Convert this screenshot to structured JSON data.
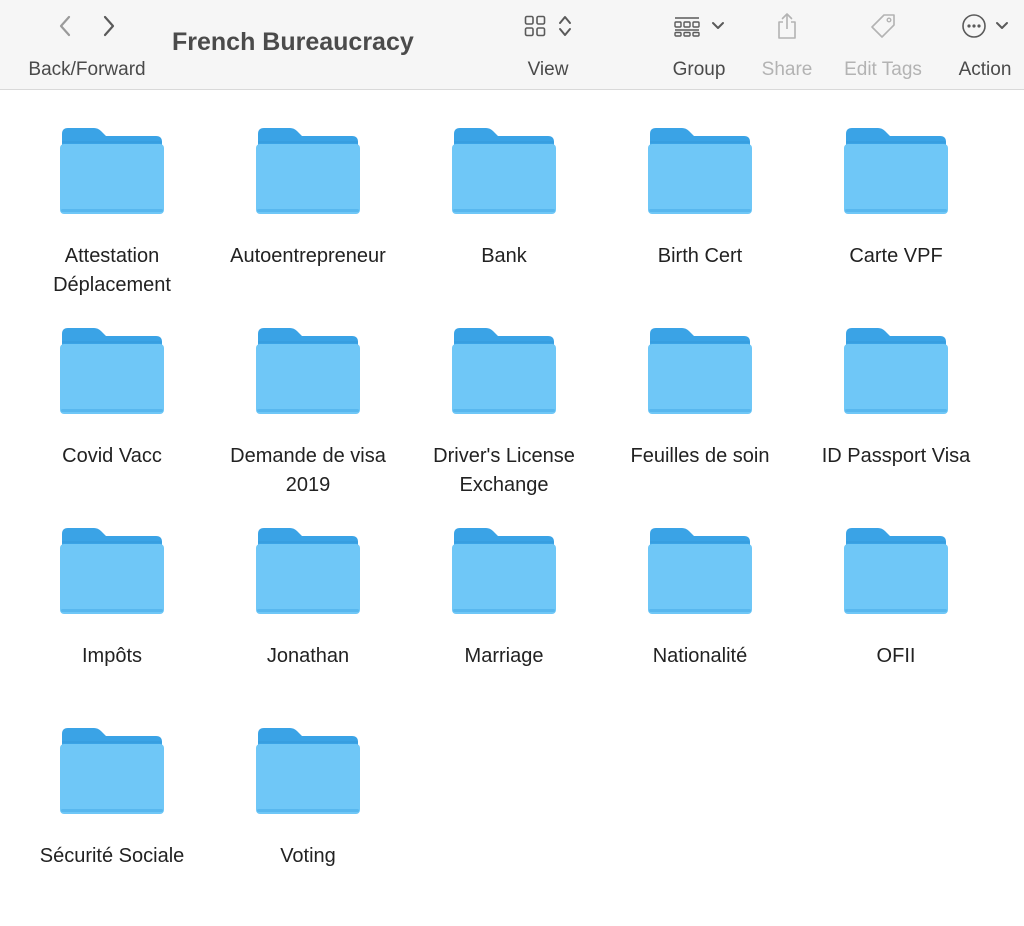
{
  "window": {
    "title": "French Bureaucracy"
  },
  "toolbar": {
    "nav_label": "Back/Forward",
    "view_label": "View",
    "group_label": "Group",
    "share_label": "Share",
    "tags_label": "Edit Tags",
    "action_label": "Action"
  },
  "colors": {
    "folder_back": "#3aa3e6",
    "folder_front": "#6fc7f7",
    "toolbar_bg": "#f6f6f6"
  },
  "folders": [
    {
      "name": "Attestation Déplacement"
    },
    {
      "name": "Autoentrepreneur"
    },
    {
      "name": "Bank"
    },
    {
      "name": "Birth Cert"
    },
    {
      "name": "Carte VPF"
    },
    {
      "name": "Covid Vacc"
    },
    {
      "name": "Demande de visa 2019"
    },
    {
      "name": "Driver's License Exchange"
    },
    {
      "name": "Feuilles de soin"
    },
    {
      "name": "ID Passport Visa"
    },
    {
      "name": "Impôts"
    },
    {
      "name": "Jonathan"
    },
    {
      "name": "Marriage"
    },
    {
      "name": "Nationalité"
    },
    {
      "name": "OFII"
    },
    {
      "name": "Sécurité Sociale"
    },
    {
      "name": "Voting"
    }
  ]
}
